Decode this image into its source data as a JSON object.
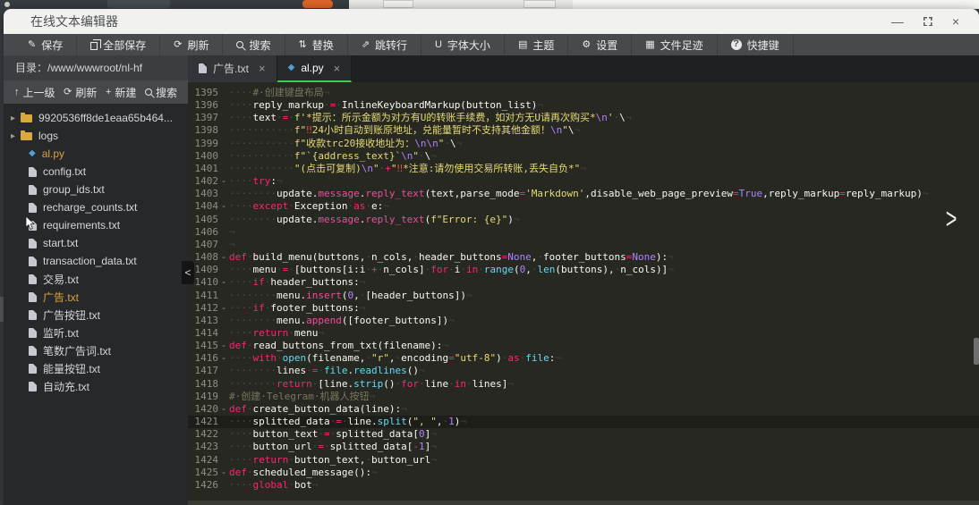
{
  "window": {
    "title": "在线文本编辑器"
  },
  "toolbar": {
    "items": [
      {
        "name": "save",
        "icon": "save",
        "label": "保存"
      },
      {
        "name": "save-all",
        "icon": "copy",
        "label": "全部保存"
      },
      {
        "name": "refresh",
        "icon": "refresh",
        "label": "刷新"
      },
      {
        "name": "search",
        "icon": "search",
        "label": "搜索"
      },
      {
        "name": "replace",
        "icon": "replace",
        "label": "替换"
      },
      {
        "name": "goto-line",
        "icon": "goto",
        "label": "跳转行"
      },
      {
        "name": "font-size",
        "icon": "font",
        "label": "字体大小"
      },
      {
        "name": "theme",
        "icon": "theme",
        "label": "主题"
      },
      {
        "name": "settings",
        "icon": "settings",
        "label": "设置"
      },
      {
        "name": "file-footprint",
        "icon": "steps",
        "label": "文件足迹"
      },
      {
        "name": "shortcuts",
        "icon": "help",
        "label": "快捷键"
      }
    ]
  },
  "sidebar": {
    "directory_label": "目录：/www/wwwroot/nl-hf",
    "actions": [
      {
        "name": "up-level",
        "icon": "up",
        "label": "上一级"
      },
      {
        "name": "refresh",
        "icon": "refresh",
        "label": "刷新"
      },
      {
        "name": "new",
        "icon": "plus",
        "label": "新建"
      },
      {
        "name": "search",
        "icon": "search",
        "label": "搜索"
      }
    ],
    "tree": [
      {
        "type": "folder",
        "label": "9920536ff8de1eaa65b464..."
      },
      {
        "type": "folder",
        "label": "logs"
      },
      {
        "type": "py",
        "label": "al.py",
        "active": true
      },
      {
        "type": "txt",
        "label": "config.txt"
      },
      {
        "type": "txt",
        "label": "group_ids.txt"
      },
      {
        "type": "txt",
        "label": "recharge_counts.txt"
      },
      {
        "type": "txt",
        "label": "requirements.txt",
        "cursor": true
      },
      {
        "type": "txt",
        "label": "start.txt"
      },
      {
        "type": "txt",
        "label": "transaction_data.txt"
      },
      {
        "type": "txt",
        "label": "交易.txt"
      },
      {
        "type": "txt",
        "label": "广告.txt",
        "active": true
      },
      {
        "type": "txt",
        "label": "广告按钮.txt"
      },
      {
        "type": "txt",
        "label": "监听.txt"
      },
      {
        "type": "txt",
        "label": "笔数广告词.txt"
      },
      {
        "type": "txt",
        "label": "能量按钮.txt"
      },
      {
        "type": "txt",
        "label": "自动充.txt"
      }
    ]
  },
  "tabs": [
    {
      "label": "广告.txt",
      "icon": "doc",
      "active": false
    },
    {
      "label": "al.py",
      "icon": "py",
      "active": true
    }
  ],
  "editor": {
    "accent_green": "#3ecf52",
    "lines": [
      {
        "n": 1395,
        "t": [
          [
            "ws",
            "····"
          ],
          [
            "c",
            "#·创建键盘布局"
          ]
        ]
      },
      {
        "n": 1396,
        "t": [
          [
            "ws",
            "····"
          ],
          [
            "p",
            "reply_markup"
          ],
          [
            "ws",
            "·"
          ],
          [
            "k",
            "="
          ],
          [
            "ws",
            "·"
          ],
          [
            "p",
            "InlineKeyboardMarkup(button_list)"
          ]
        ]
      },
      {
        "n": 1397,
        "t": [
          [
            "ws",
            "····"
          ],
          [
            "p",
            "text"
          ],
          [
            "ws",
            "·"
          ],
          [
            "k",
            "="
          ],
          [
            "ws",
            "·"
          ],
          [
            "s",
            "f'*提示：所示金额为对方有U的转账手续费，如对方无U请再次购买*"
          ],
          [
            "e",
            "\\n"
          ],
          [
            "s",
            "'"
          ],
          [
            "ws",
            "·"
          ],
          [
            "p",
            "\\"
          ]
        ]
      },
      {
        "n": 1398,
        "t": [
          [
            "ws",
            "···········"
          ],
          [
            "s",
            "f\""
          ],
          [
            "x",
            "‼"
          ],
          [
            "s",
            "24小时自动到账原地址，兑能量暂时不支持其他金额！"
          ],
          [
            "e",
            "\\n"
          ],
          [
            "s",
            "\""
          ],
          [
            "p",
            "\\"
          ]
        ]
      },
      {
        "n": 1399,
        "t": [
          [
            "ws",
            "···········"
          ],
          [
            "s",
            "f\"收款trc20接收地址为："
          ],
          [
            "e",
            "\\n\\n"
          ],
          [
            "s",
            "\""
          ],
          [
            "ws",
            "·"
          ],
          [
            "p",
            "\\"
          ]
        ]
      },
      {
        "n": 1400,
        "t": [
          [
            "ws",
            "···········"
          ],
          [
            "s",
            "f\"`{address_text}`"
          ],
          [
            "e",
            "\\n"
          ],
          [
            "s",
            "\""
          ],
          [
            "ws",
            "·"
          ],
          [
            "p",
            "\\"
          ]
        ]
      },
      {
        "n": 1401,
        "t": [
          [
            "ws",
            "···········"
          ],
          [
            "s",
            "\"(点击可复制)"
          ],
          [
            "e",
            "\\n"
          ],
          [
            "s",
            "\""
          ],
          [
            "ws",
            "·"
          ],
          [
            "k",
            "+"
          ],
          [
            "s",
            "\""
          ],
          [
            "x",
            "‼"
          ],
          [
            "s",
            "*注意:请勿使用交易所转账,丢失自负*\""
          ]
        ]
      },
      {
        "n": 1402,
        "f": 1,
        "t": [
          [
            "ws",
            "····"
          ],
          [
            "k",
            "try"
          ],
          [
            "p",
            ":"
          ]
        ]
      },
      {
        "n": 1403,
        "t": [
          [
            "ws",
            "········"
          ],
          [
            "p",
            "update."
          ],
          [
            "m",
            "message"
          ],
          [
            "p",
            "."
          ],
          [
            "m",
            "reply_text"
          ],
          [
            "p",
            "(text,parse_mode"
          ],
          [
            "k",
            "="
          ],
          [
            "s",
            "'Markdown'"
          ],
          [
            "p",
            ",disable_web_page_preview"
          ],
          [
            "k",
            "="
          ],
          [
            "e",
            "True"
          ],
          [
            "p",
            ",reply_markup"
          ],
          [
            "k",
            "="
          ],
          [
            "p",
            "reply_markup)"
          ]
        ]
      },
      {
        "n": 1404,
        "f": 1,
        "t": [
          [
            "ws",
            "····"
          ],
          [
            "k",
            "except"
          ],
          [
            "ws",
            "·"
          ],
          [
            "p",
            "Exception"
          ],
          [
            "ws",
            "·"
          ],
          [
            "k",
            "as"
          ],
          [
            "ws",
            "·"
          ],
          [
            "p",
            "e:"
          ]
        ]
      },
      {
        "n": 1405,
        "t": [
          [
            "ws",
            "········"
          ],
          [
            "p",
            "update."
          ],
          [
            "m",
            "message"
          ],
          [
            "p",
            "."
          ],
          [
            "m",
            "reply_text"
          ],
          [
            "p",
            "("
          ],
          [
            "s",
            "f\"Error: {e}\""
          ],
          [
            "p",
            ")"
          ]
        ]
      },
      {
        "n": 1406,
        "t": []
      },
      {
        "n": 1407,
        "t": []
      },
      {
        "n": 1408,
        "f": 1,
        "t": [
          [
            "k",
            "def"
          ],
          [
            "ws",
            "·"
          ],
          [
            "p",
            "build_menu(buttons,"
          ],
          [
            "ws",
            "·"
          ],
          [
            "p",
            "n_cols,"
          ],
          [
            "ws",
            "·"
          ],
          [
            "p",
            "header_buttons"
          ],
          [
            "k",
            "="
          ],
          [
            "e",
            "None"
          ],
          [
            "p",
            ","
          ],
          [
            "ws",
            "·"
          ],
          [
            "p",
            "footer_buttons"
          ],
          [
            "k",
            "="
          ],
          [
            "e",
            "None"
          ],
          [
            "p",
            "):"
          ]
        ]
      },
      {
        "n": 1409,
        "t": [
          [
            "ws",
            "····"
          ],
          [
            "p",
            "menu"
          ],
          [
            "ws",
            "·"
          ],
          [
            "k",
            "="
          ],
          [
            "ws",
            "·"
          ],
          [
            "p",
            "[buttons[i:i"
          ],
          [
            "ws",
            "·"
          ],
          [
            "k",
            "+"
          ],
          [
            "ws",
            "·"
          ],
          [
            "p",
            "n_cols]"
          ],
          [
            "ws",
            "·"
          ],
          [
            "k",
            "for"
          ],
          [
            "ws",
            "·"
          ],
          [
            "p",
            "i"
          ],
          [
            "ws",
            "·"
          ],
          [
            "k",
            "in"
          ],
          [
            "ws",
            "·"
          ],
          [
            "b",
            "range"
          ],
          [
            "p",
            "("
          ],
          [
            "e",
            "0"
          ],
          [
            "p",
            ","
          ],
          [
            "ws",
            "·"
          ],
          [
            "b",
            "len"
          ],
          [
            "p",
            "(buttons),"
          ],
          [
            "ws",
            "·"
          ],
          [
            "p",
            "n_cols)]"
          ]
        ]
      },
      {
        "n": 1410,
        "f": 1,
        "t": [
          [
            "ws",
            "····"
          ],
          [
            "k",
            "if"
          ],
          [
            "ws",
            "·"
          ],
          [
            "p",
            "header_buttons:"
          ]
        ]
      },
      {
        "n": 1411,
        "t": [
          [
            "ws",
            "········"
          ],
          [
            "p",
            "menu."
          ],
          [
            "m",
            "insert"
          ],
          [
            "p",
            "("
          ],
          [
            "e",
            "0"
          ],
          [
            "p",
            ","
          ],
          [
            "ws",
            "·"
          ],
          [
            "p",
            "[header_buttons])"
          ]
        ]
      },
      {
        "n": 1412,
        "f": 1,
        "t": [
          [
            "ws",
            "····"
          ],
          [
            "k",
            "if"
          ],
          [
            "ws",
            "·"
          ],
          [
            "p",
            "footer_buttons:"
          ]
        ]
      },
      {
        "n": 1413,
        "t": [
          [
            "ws",
            "········"
          ],
          [
            "p",
            "menu."
          ],
          [
            "m",
            "append"
          ],
          [
            "p",
            "([footer_buttons])"
          ]
        ]
      },
      {
        "n": 1414,
        "t": [
          [
            "ws",
            "····"
          ],
          [
            "k",
            "return"
          ],
          [
            "ws",
            "·"
          ],
          [
            "p",
            "menu"
          ]
        ]
      },
      {
        "n": 1415,
        "f": 1,
        "t": [
          [
            "k",
            "def"
          ],
          [
            "ws",
            "·"
          ],
          [
            "p",
            "read_buttons_from_txt(filename):"
          ]
        ]
      },
      {
        "n": 1416,
        "f": 1,
        "t": [
          [
            "ws",
            "····"
          ],
          [
            "k",
            "with"
          ],
          [
            "ws",
            "·"
          ],
          [
            "b",
            "open"
          ],
          [
            "p",
            "(filename,"
          ],
          [
            "ws",
            "·"
          ],
          [
            "s",
            "\"r\""
          ],
          [
            "p",
            ","
          ],
          [
            "ws",
            "·"
          ],
          [
            "p",
            "encoding"
          ],
          [
            "k",
            "="
          ],
          [
            "s",
            "\"utf-8\""
          ],
          [
            "p",
            ")"
          ],
          [
            "ws",
            "·"
          ],
          [
            "k",
            "as"
          ],
          [
            "ws",
            "·"
          ],
          [
            "b",
            "file"
          ],
          [
            "p",
            ":"
          ]
        ]
      },
      {
        "n": 1417,
        "t": [
          [
            "ws",
            "········"
          ],
          [
            "p",
            "lines"
          ],
          [
            "ws",
            "·"
          ],
          [
            "k",
            "="
          ],
          [
            "ws",
            "·"
          ],
          [
            "b",
            "file"
          ],
          [
            "p",
            "."
          ],
          [
            "b",
            "readlines"
          ],
          [
            "p",
            "()"
          ]
        ]
      },
      {
        "n": 1418,
        "t": [
          [
            "ws",
            "········"
          ],
          [
            "k",
            "return"
          ],
          [
            "ws",
            "·"
          ],
          [
            "p",
            "[line."
          ],
          [
            "b",
            "strip"
          ],
          [
            "p",
            "()"
          ],
          [
            "ws",
            "·"
          ],
          [
            "k",
            "for"
          ],
          [
            "ws",
            "·"
          ],
          [
            "p",
            "line"
          ],
          [
            "ws",
            "·"
          ],
          [
            "k",
            "in"
          ],
          [
            "ws",
            "·"
          ],
          [
            "p",
            "lines]"
          ]
        ]
      },
      {
        "n": 1419,
        "t": [
          [
            "c",
            "#·创建·Telegram·机器人按钮"
          ]
        ]
      },
      {
        "n": 1420,
        "f": 1,
        "t": [
          [
            "k",
            "def"
          ],
          [
            "ws",
            "·"
          ],
          [
            "p",
            "create_button_data(line):"
          ]
        ]
      },
      {
        "n": 1421,
        "cur": 1,
        "t": [
          [
            "ws",
            "····"
          ],
          [
            "p",
            "splitted_data"
          ],
          [
            "ws",
            "·"
          ],
          [
            "k",
            "="
          ],
          [
            "ws",
            "·"
          ],
          [
            "p",
            "line."
          ],
          [
            "b",
            "split"
          ],
          [
            "p",
            "("
          ],
          [
            "s",
            "\", \""
          ],
          [
            "p",
            ","
          ],
          [
            "ws",
            "·"
          ],
          [
            "e",
            "1"
          ],
          [
            "p",
            ")"
          ]
        ]
      },
      {
        "n": 1422,
        "t": [
          [
            "ws",
            "····"
          ],
          [
            "p",
            "button_text"
          ],
          [
            "ws",
            "·"
          ],
          [
            "k",
            "="
          ],
          [
            "ws",
            "·"
          ],
          [
            "p",
            "splitted_data["
          ],
          [
            "e",
            "0"
          ],
          [
            "p",
            "]"
          ]
        ]
      },
      {
        "n": 1423,
        "t": [
          [
            "ws",
            "····"
          ],
          [
            "p",
            "button_url"
          ],
          [
            "ws",
            "·"
          ],
          [
            "k",
            "="
          ],
          [
            "ws",
            "·"
          ],
          [
            "p",
            "splitted_data["
          ],
          [
            "k",
            "-"
          ],
          [
            "e",
            "1"
          ],
          [
            "p",
            "]"
          ]
        ]
      },
      {
        "n": 1424,
        "t": [
          [
            "ws",
            "····"
          ],
          [
            "k",
            "return"
          ],
          [
            "ws",
            "·"
          ],
          [
            "p",
            "button_text,"
          ],
          [
            "ws",
            "·"
          ],
          [
            "p",
            "button_url"
          ]
        ]
      },
      {
        "n": 1425,
        "f": 1,
        "t": [
          [
            "k",
            "def"
          ],
          [
            "ws",
            "·"
          ],
          [
            "p",
            "scheduled_message():"
          ]
        ]
      },
      {
        "n": 1426,
        "t": [
          [
            "ws",
            "····"
          ],
          [
            "k",
            "global"
          ],
          [
            "ws",
            "·"
          ],
          [
            "p",
            "bot"
          ]
        ]
      }
    ]
  }
}
